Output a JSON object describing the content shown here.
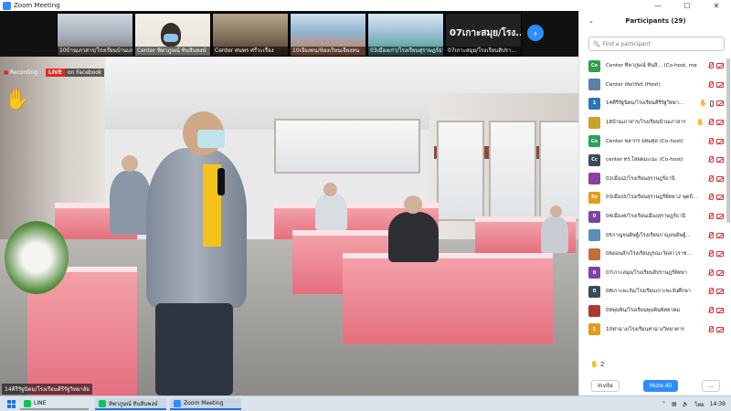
{
  "window": {
    "title": "Zoom Meeting",
    "controls": [
      "—",
      "☐",
      "✕"
    ]
  },
  "thumbnails": [
    {
      "label": "10บ้านเภาสาร/โรงเรียนบ้านเภาสาร"
    },
    {
      "label": "Center ทิพาภูษณ์ ทินสินพงษ์"
    },
    {
      "label": "Center ศนพร ศรีวะเรื่อง"
    },
    {
      "label": "10เจียงทน/ห้องเรียนเจียงทน"
    },
    {
      "label": "03เมืองเก่า/โรงเรียนสุราษฎร์ธานี"
    },
    {
      "label": "07เกาะสมุย/โรงเรียนสิปรา..."
    }
  ],
  "thumbnail_highlight": "07เกาะสมุย/โรง...",
  "overlay": {
    "recording": "Recording",
    "live": "LIVE",
    "live_on": "on Facebook",
    "speaker": "14คีรีรัฐนิคม/โรงเรียนคีรีรัฐวิทยาลัย"
  },
  "panel": {
    "title": "Participants (29)",
    "search_placeholder": "Find a participant",
    "raised_count": "2",
    "invite": "Invite",
    "mute_all": "Mute All",
    "more": "..."
  },
  "participants": [
    {
      "initials": "Cn",
      "color": "#2e9e4f",
      "name": "Center ทิพาภูษณ์ ทินสิ... (Co-host, me)"
    },
    {
      "initials": "",
      "color": "#5b7fa6",
      "name": "Center สพกรพร (Host)"
    },
    {
      "initials": "1",
      "color": "#2b74b8",
      "name": "14คีรีรัฐนิคม/โรงเรียนคีรีรัฐวิทยา..."
    },
    {
      "initials": "",
      "color": "#c9a22c",
      "name": "18บ้านเภาสาร/โรงเรียนบ้านเภาสาร"
    },
    {
      "initials": "Cn",
      "color": "#27a35a",
      "name": "Center พลากร ปทมศุล (Co-host)"
    },
    {
      "initials": "Cc",
      "color": "#3e4a59",
      "name": "center ทร.ไสผดมะเนะ (Co-host)"
    },
    {
      "initials": "",
      "color": "#8a3fa3",
      "name": "02เมือง2/โรงเรียนสุราษฎร์ธานี"
    },
    {
      "initials": "0s",
      "color": "#e39b1b",
      "name": "03เมือง3/โรงเรียนสุราษฎร์พิทยา2 พุดถี..."
    },
    {
      "initials": "0",
      "color": "#7d43a6",
      "name": "04เมือง4/โรงเรียนเมืองสุราษฎร์ธานี"
    },
    {
      "initials": "",
      "color": "#5b8fb3",
      "name": "05กาญจนดิษฐ์/โรงเรียนกาญจนดิษฐ์..."
    },
    {
      "initials": "",
      "color": "#c46b3c",
      "name": "06ดอนสัก/โรงเรียนบูรณะวัดสาวุราช..."
    },
    {
      "initials": "0",
      "color": "#7d43a6",
      "name": "07เกาะสมุย/โรงเรียนสิปราษฎร์พิทยา"
    },
    {
      "initials": "0",
      "color": "#3e4a59",
      "name": "08เกาะพะงัน/โรงเรียนเกาะพะงันศึกษา"
    },
    {
      "initials": "",
      "color": "#a83b2f",
      "name": "09พุนพิน/โรงเรียนพุนพินพิทยาคม"
    },
    {
      "initials": "1",
      "color": "#e39b1b",
      "name": "10ท่าฉาง/โรงเรียนท่าฉางวิทยาคาร"
    }
  ],
  "taskbar": {
    "items": [
      "LINE",
      "ทิพาภูษณ์ ทินสินพงษ์",
      "Zoom Meeting"
    ],
    "lang": "ไทย",
    "time": "14:39"
  }
}
